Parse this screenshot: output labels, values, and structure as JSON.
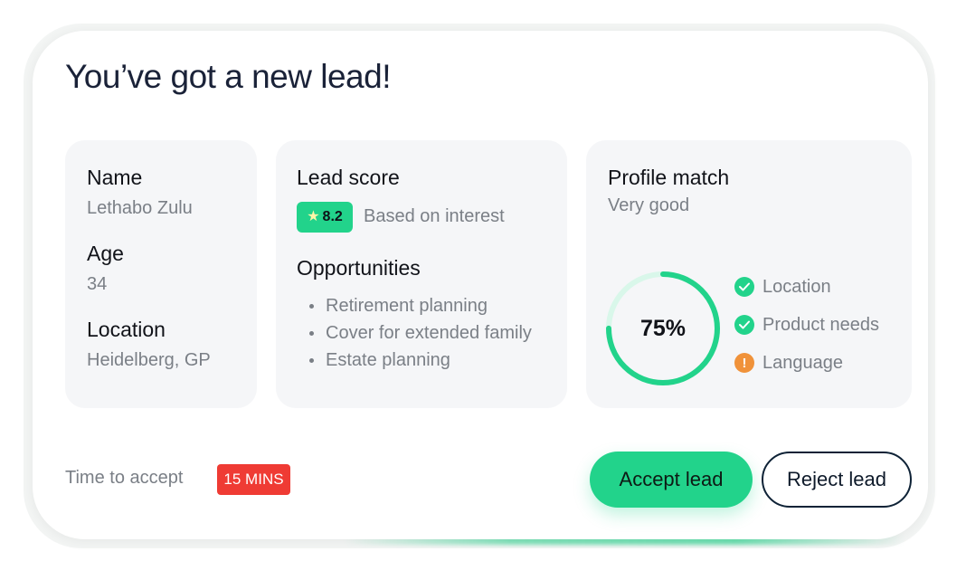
{
  "header": {
    "title": "You’ve got a new lead!"
  },
  "lead": {
    "name_label": "Name",
    "name_value": "Lethabo Zulu",
    "age_label": "Age",
    "age_value": "34",
    "location_label": "Location",
    "location_value": "Heidelberg, GP"
  },
  "score": {
    "label": "Lead score",
    "value": "8.2",
    "star_icon": "star-icon",
    "note": "Based on interest",
    "badge_color": "#22d38b"
  },
  "opportunities": {
    "label": "Opportunities",
    "items": [
      "Retirement planning",
      "Cover for extended family",
      "Estate planning"
    ]
  },
  "profile_match": {
    "label": "Profile match",
    "rating": "Very good",
    "percent_text": "75%",
    "percent_value": 0.75,
    "ring_color": "#22d38b",
    "ring_track_color": "#d9f7ea",
    "criteria": [
      {
        "label": "Location",
        "status": "ok",
        "icon": "check-icon"
      },
      {
        "label": "Product needs",
        "status": "ok",
        "icon": "check-icon"
      },
      {
        "label": "Language",
        "status": "warning",
        "icon": "exclamation-icon"
      }
    ]
  },
  "footer": {
    "time_label": "Time to accept",
    "timer_value": "15 MINS",
    "timer_color": "#ef3b34",
    "accept_label": "Accept lead",
    "reject_label": "Reject lead"
  },
  "colors": {
    "accent": "#22d38b",
    "warning": "#f0923a",
    "title_text": "#1a2238"
  }
}
